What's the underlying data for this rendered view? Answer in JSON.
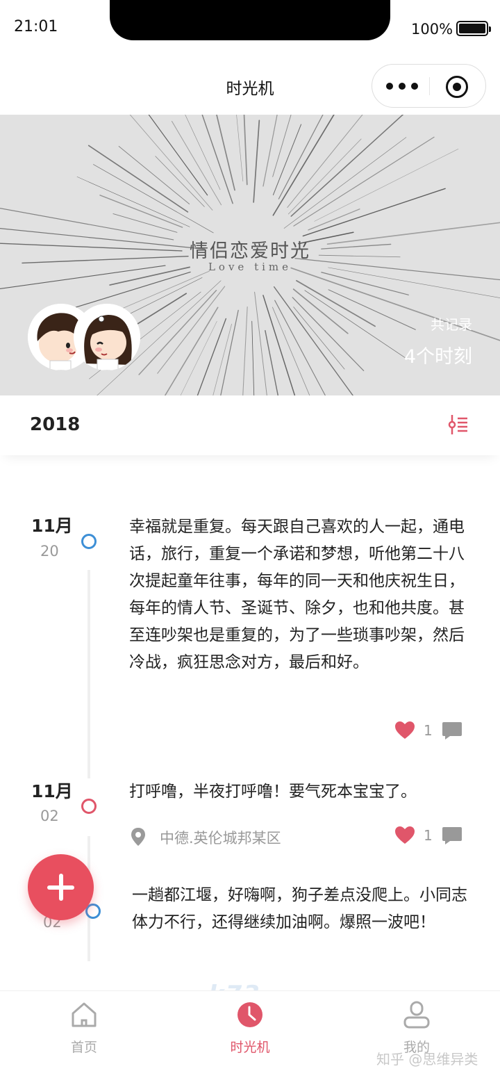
{
  "status_bar": {
    "time": "21:01",
    "battery": "100%"
  },
  "nav": {
    "title": "时光机"
  },
  "banner": {
    "title": "情侣恋爱时光",
    "subtitle": "Love time",
    "records_label": "共记录",
    "records_count": "4个时刻"
  },
  "year": "2018",
  "posts": [
    {
      "month": "11月",
      "day": "20",
      "dot_color": "#3d8fd6",
      "text": "幸福就是重复。每天跟自己喜欢的人一起，通电话，旅行，重复一个承诺和梦想，听他第二十八次提起童年往事，每年的同一天和他庆祝生日，每年的情人节、圣诞节、除夕，也和他共度。甚至连吵架也是重复的，为了一些琐事吵架，然后冷战，疯狂思念对方，最后和好。",
      "likes": "1"
    },
    {
      "month": "11月",
      "day": "02",
      "dot_color": "#e0566a",
      "text": "打呼噜，半夜打呼噜！要气死本宝宝了。",
      "location": "中德.英伦城邦某区",
      "likes": "1"
    },
    {
      "month": "",
      "day": "02",
      "dot_color": "#3d8fd6",
      "text": "一趟都江堰，好嗨啊，狗子差点没爬上。小同志体力不行，还得继续加油啊。爆照一波吧！"
    }
  ],
  "tabs": [
    {
      "label": "首页",
      "icon": "home-icon",
      "active": false
    },
    {
      "label": "时光机",
      "icon": "clock-icon",
      "active": true
    },
    {
      "label": "我的",
      "icon": "user-icon",
      "active": false
    }
  ],
  "watermark": "知乎 @思维异类",
  "logo_watermark": "k73",
  "colors": {
    "accent": "#e0566a",
    "blue_dot": "#3d8fd6",
    "fab": "#e84f5f"
  }
}
